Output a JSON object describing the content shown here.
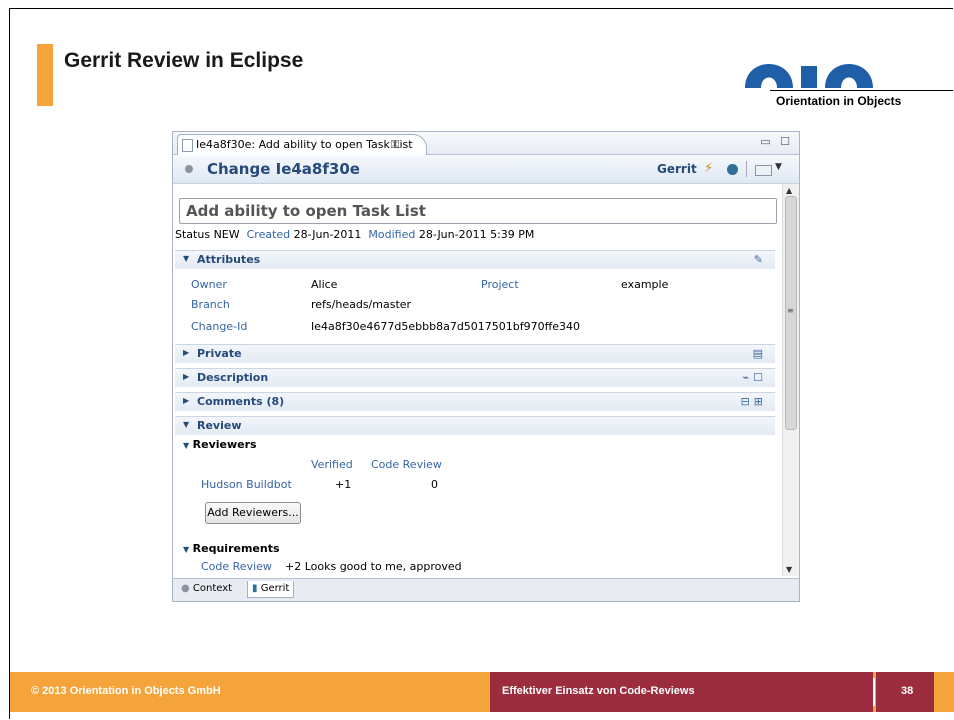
{
  "slide": {
    "title": "Gerrit Review in Eclipse",
    "logo_text": "Orientation in Objects",
    "footer_left": "© 2013 Orientation in Objects GmbH",
    "footer_center": "Effektiver Einsatz von Code-Reviews",
    "page_number": "38",
    "accent_color": "#f4a43a",
    "footer_dark_color": "#9c2d3e",
    "logo_color": "#1f5fa8"
  },
  "editor": {
    "tab_title": "Ie4a8f30e: Add ability to open Task List",
    "tab_close": "☒",
    "window_controls": "▭ ☐",
    "header_title": "Change Ie4a8f30e",
    "header_gerrit": "Gerrit",
    "summary": "Add ability to open Task List",
    "status_label": "Status",
    "status_value": "NEW",
    "created_label": "Created",
    "created_value": "28-Jun-2011",
    "modified_label": "Modified",
    "modified_value": "28-Jun-2011 5:39 PM",
    "attributes": {
      "title": "Attributes",
      "owner_label": "Owner",
      "owner_value": "Alice",
      "project_label": "Project",
      "project_value": "example",
      "branch_label": "Branch",
      "branch_value": "refs/heads/master",
      "changeid_label": "Change-Id",
      "changeid_value": "Ie4a8f30e4677d5ebbb8a7d5017501bf970ffe340"
    },
    "sections": {
      "private": "Private",
      "description": "Description",
      "comments": "Comments (8)",
      "review": "Review"
    },
    "reviewers": {
      "title": "Reviewers",
      "col_verified": "Verified",
      "col_code_review": "Code Review",
      "rows": [
        {
          "name": "Hudson Buildbot",
          "verified": "+1",
          "code_review": "0"
        }
      ],
      "add_button": "Add Reviewers..."
    },
    "requirements": {
      "title": "Requirements",
      "label": "Code Review",
      "value": "+2 Looks good to me, approved"
    },
    "bottom_tabs": [
      {
        "label": "Context"
      },
      {
        "label": "Gerrit"
      }
    ]
  }
}
